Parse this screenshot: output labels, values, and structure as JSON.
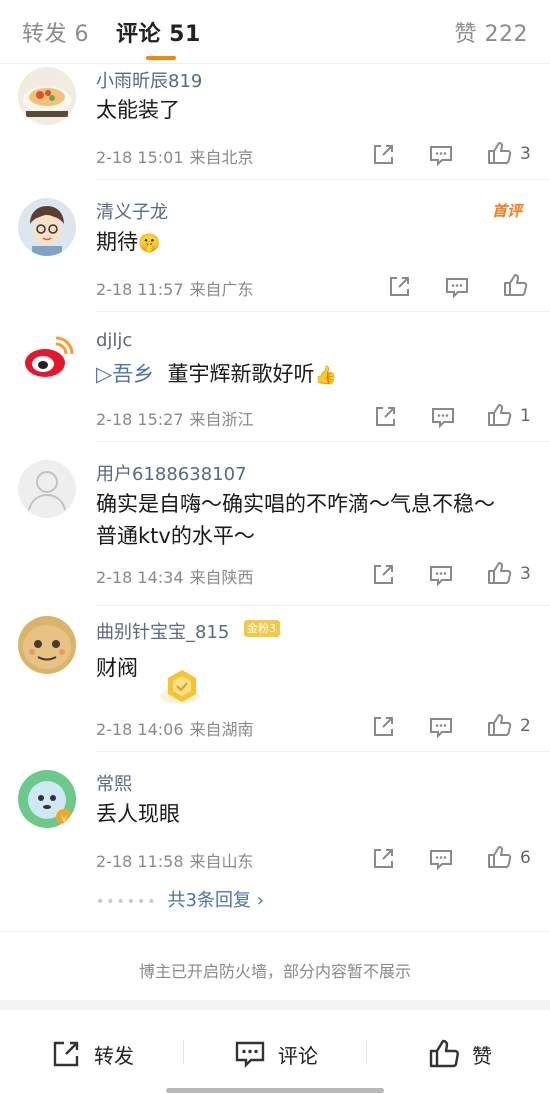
{
  "tabs": {
    "repost": "转发 6",
    "comments": "评论 51",
    "likes": "赞 222"
  },
  "comments": [
    {
      "username": "小雨昕辰819",
      "text": "太能装了",
      "time": "2-18 15:01",
      "location": "来自北京",
      "likes": "3"
    },
    {
      "username": "清义子龙",
      "badge": "首评",
      "text": "期待",
      "emoji": "🤫",
      "time": "2-18 11:57",
      "location": "来自广东",
      "likes": ""
    },
    {
      "username": "djljc",
      "topic": "▷吾乡",
      "text": "董宇辉新歌好听",
      "emoji": "👍",
      "time": "2-18 15:27",
      "location": "来自浙江",
      "likes": "1"
    },
    {
      "username": "用户6188638107",
      "text": "确实是自嗨～确实唱的不咋滴～气息不稳～普通ktv的水平～",
      "time": "2-18 14:34",
      "location": "来自陕西",
      "likes": "3"
    },
    {
      "username": "曲别针宝宝_815",
      "fan_badge": "金粉3",
      "text": "财阀",
      "time": "2-18 14:06",
      "location": "来自湖南",
      "likes": "2"
    },
    {
      "username": "常熙",
      "text": "丢人现眼",
      "time": "2-18 11:58",
      "location": "来自山东",
      "likes": "6",
      "replies": "共3条回复 ›"
    }
  ],
  "notice": "博主已开启防火墙，部分内容暂不展示",
  "bottom_bar": {
    "repost": "转发",
    "comment": "评论",
    "like": "赞"
  },
  "colors": {
    "accent": "#ff8200",
    "link": "#4b74ad",
    "username": "#5a6a84"
  }
}
